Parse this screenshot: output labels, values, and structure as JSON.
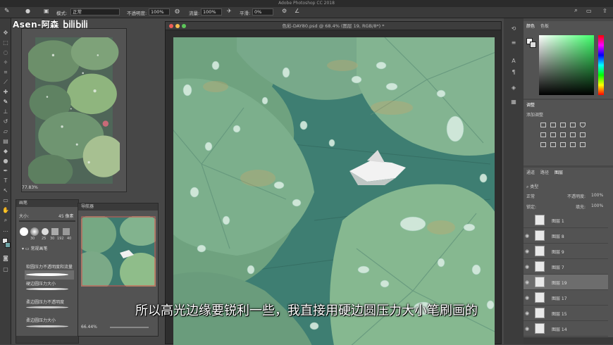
{
  "app": {
    "title": "Adobe Photoshop CC 2018"
  },
  "options_bar": {
    "mode_label": "模式:",
    "mode_value": "正常",
    "opacity_label": "不透明度:",
    "opacity_value": "100%",
    "flow_label": "流量:",
    "flow_value": "100%",
    "smooth_label": "平滑:",
    "smooth_value": "0%"
  },
  "watermark": {
    "text": "Asen-阿森"
  },
  "reference": {
    "zoom": "77.83%"
  },
  "brush_panel": {
    "title": "画笔",
    "size_label": "大小:",
    "size_value": "45 像素",
    "presets": [
      "30",
      "25",
      "30",
      "192",
      "40"
    ],
    "group": "常规画笔",
    "items": [
      "软圆压力不透明度和流量",
      "硬边圆压力大小",
      "柔边圆压力不透明度",
      "柔边圆压力大小"
    ]
  },
  "navigator": {
    "title": "导航器",
    "zoom": "66.44%"
  },
  "document": {
    "title": "色彩-DAY80.psd @ 68.4% (图层 19, RGB/8*) *"
  },
  "color_panel": {
    "tabs": [
      "颜色",
      "色板"
    ]
  },
  "adjust_panel": {
    "title": "调整",
    "subtitle": "添加调整"
  },
  "layer_panel": {
    "tabs": [
      "通道",
      "路径",
      "图层"
    ],
    "filter": "类型",
    "blend": "正常",
    "opacity_label": "不透明度:",
    "opacity_value": "100%",
    "lock_label": "锁定:",
    "fill_label": "填充:",
    "fill_value": "100%",
    "layers": [
      "图层 1",
      "图层 8",
      "图层 9",
      "图层 7",
      "图层 19",
      "图层 17",
      "图层 15",
      "图层 14"
    ]
  },
  "caption": {
    "text": "所以高光边缘要锐利一些，我直接用硬边圆压力大小笔刷画的"
  },
  "colors": {
    "accent": "#5d9c86",
    "water": "#3d7a6f",
    "leaf": "#7fb38f",
    "selected_layer": "#6d6d6d"
  }
}
